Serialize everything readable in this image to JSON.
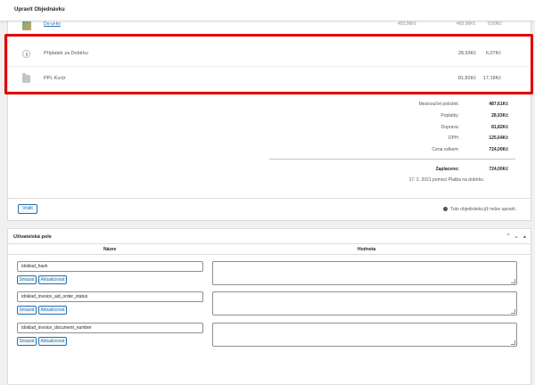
{
  "header": {
    "title": "Upravit Objednávku"
  },
  "previous_item": {
    "link": "Do-ui-ko",
    "v1": "493,96Kč",
    "v2": "493,96Kč",
    "v3": "0,00Kč"
  },
  "fees": [
    {
      "label": "Příplatek za Dobírku",
      "v1": "28,93Kč",
      "v2": "6,07Kč",
      "icon": "coin-icon"
    },
    {
      "label": "PPL Kurýr",
      "v1": "81,82Kč",
      "v2": "17,18Kč",
      "icon": "folder-icon"
    }
  ],
  "totals": [
    {
      "label": "Mezisoučet položek:",
      "value": "487,61Kč"
    },
    {
      "label": "Poplatky:",
      "value": "28,93Kč"
    },
    {
      "label": "Doprava:",
      "value": "81,82Kč"
    },
    {
      "label": "DPH:",
      "value": "125,64Kč"
    },
    {
      "label": "Cena celkem:",
      "value": "724,00Kč"
    }
  ],
  "paid": {
    "label": "Zaplaceno:",
    "value": "724,00Kč",
    "note": "17. 2. 2021 pomocí Platba na dobírku"
  },
  "actions": {
    "refund": "Vrátit",
    "locked_note": "Tuto objednávku již nelze upravit."
  },
  "custom_fields": {
    "title": "Uživatelská pole",
    "col_name": "Název",
    "col_value": "Hodnota",
    "delete_label": "Smazat",
    "update_label": "Aktualizovat",
    "rows": [
      {
        "name": "idoklad_hash",
        "value": ""
      },
      {
        "name": "idoklad_invoice_aid_order_status",
        "value": ""
      },
      {
        "name": "idoklad_invoice_document_number",
        "value": ""
      }
    ]
  }
}
